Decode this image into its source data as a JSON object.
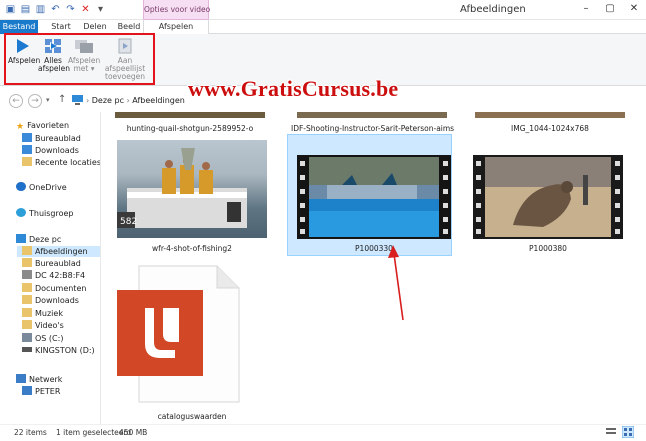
{
  "window": {
    "title": "Afbeeldingen",
    "context_tab_group": "Opties voor video",
    "controls": [
      "–",
      "▢",
      "✕"
    ]
  },
  "tabs": [
    "Bestand",
    "Start",
    "Delen",
    "Beeld",
    "Afspelen"
  ],
  "ribbon": {
    "play": "Afspelen",
    "play_all_1": "Alles",
    "play_all_2": "afspelen",
    "play_with_1": "Afspelen",
    "play_with_2": "met",
    "add_playlist_1": "Aan afspeellijst",
    "add_playlist_2": "toevoegen"
  },
  "watermark": "www.GratisCursus.be",
  "address": {
    "path_1": "Deze pc",
    "path_2": "Afbeeldingen"
  },
  "sidebar": {
    "favorites": "Favorieten",
    "desktop": "Bureaublad",
    "downloads": "Downloads",
    "recent": "Recente locaties",
    "onedrive": "OneDrive",
    "homegroup": "Thuisgroep",
    "thispc": "Deze pc",
    "pictures": "Afbeeldingen",
    "desktop2": "Bureaublad",
    "dc": "DC 42:B8:F4",
    "documents": "Documenten",
    "downloads2": "Downloads",
    "music": "Muziek",
    "videos": "Video's",
    "osc": "OS (C:)",
    "kingston": "KINGSTON (D:)",
    "network": "Netwerk",
    "peter": "PETER"
  },
  "files": {
    "f1": "hunting-quail-shotgun-2589952-o",
    "f2": "IDF-Shooting-Instructor-Sarit-Peterson-aims",
    "f3": "IMG_1044-1024x768",
    "f4": "wfr-4-shot-of-fishing2",
    "f5": "P1000330",
    "f6": "P1000380",
    "f7": "cataloguswaarden"
  },
  "status": {
    "items": "22 items",
    "selected": "1 item geselecteerd",
    "size": "450 MB"
  },
  "colors": {
    "file_tab": "#1979ca",
    "context_tab": "#f6dff2",
    "selection": "#cde8ff",
    "highlight_box": "#e3121b",
    "watermark": "#cc0e0e",
    "doc_icon": "#d24726"
  }
}
